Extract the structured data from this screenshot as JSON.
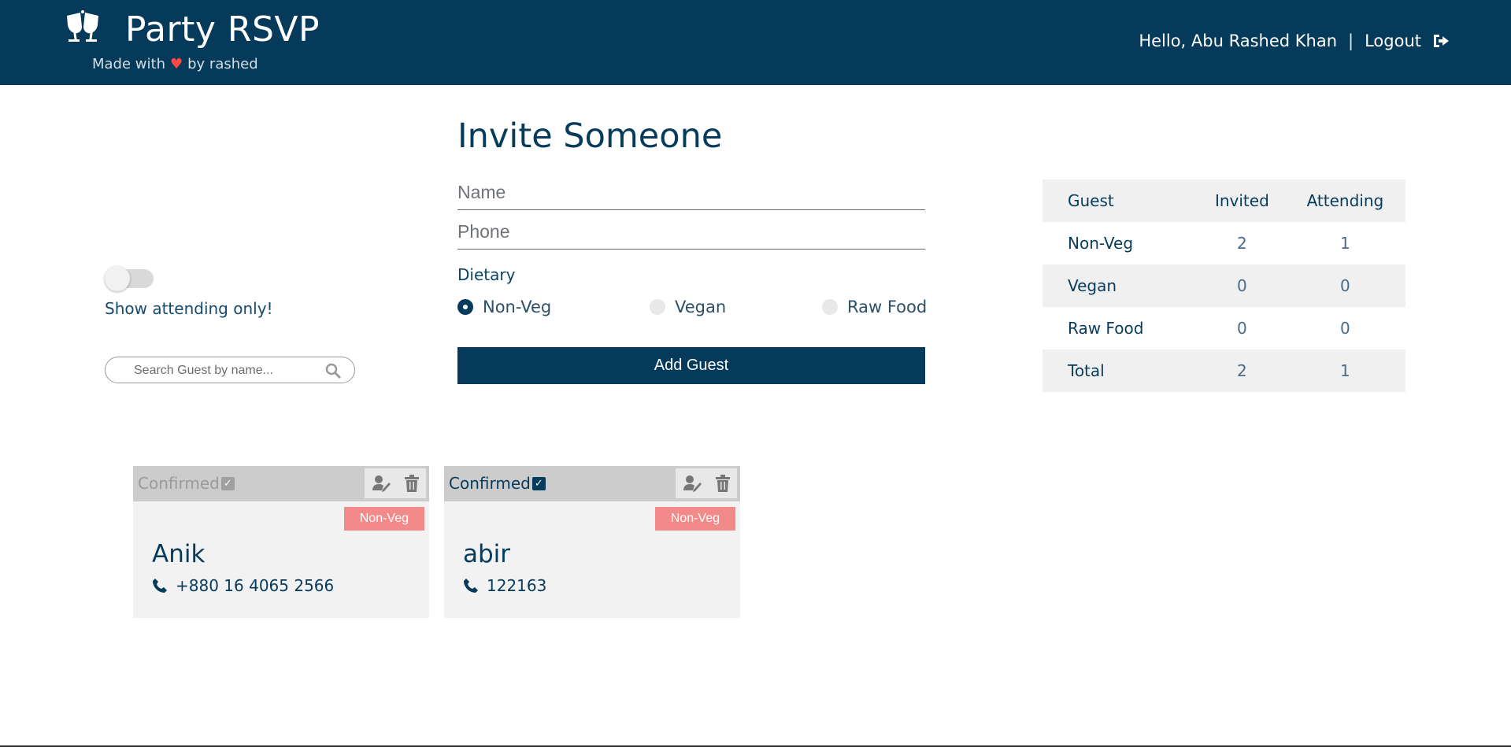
{
  "header": {
    "app_title": "Party RSVP",
    "tagline_before": "Made with",
    "tagline_after": "by rashed",
    "greeting": "Hello, Abu Rashed Khan",
    "separator": "|",
    "logout_label": "Logout",
    "logo_icon": "glasses-cheers-icon",
    "logout_icon": "sign-out-icon",
    "bg_color": "#063a5b",
    "heart_color": "#ff4a43"
  },
  "filters": {
    "toggle_label": "Show attending only!",
    "toggle_on": false,
    "search_placeholder": "Search Guest by name..."
  },
  "invite": {
    "title": "Invite Someone",
    "name_placeholder": "Name",
    "phone_placeholder": "Phone",
    "dietary_label": "Dietary",
    "options": [
      {
        "label": "Non-Veg",
        "selected": true
      },
      {
        "label": "Vegan",
        "selected": false
      },
      {
        "label": "Raw Food",
        "selected": false
      }
    ],
    "submit_label": "Add Guest"
  },
  "stats": {
    "headers": [
      "Guest",
      "Invited",
      "Attending"
    ],
    "rows": [
      [
        "Non-Veg",
        "2",
        "1"
      ],
      [
        "Vegan",
        "0",
        "0"
      ],
      [
        "Raw Food",
        "0",
        "0"
      ],
      [
        "Total",
        "2",
        "1"
      ]
    ]
  },
  "guests": [
    {
      "status": "Confirmed",
      "confirmed": false,
      "diet": "Non-Veg",
      "name": "Anik",
      "phone": "+880 16 4065 2566"
    },
    {
      "status": "Confirmed",
      "confirmed": true,
      "diet": "Non-Veg",
      "name": "abir",
      "phone": "122163"
    }
  ],
  "colors": {
    "accent": "#073b5c",
    "badge": "#f28a89",
    "card_bg": "#f2f2f2",
    "card_header": "#cccccc"
  }
}
